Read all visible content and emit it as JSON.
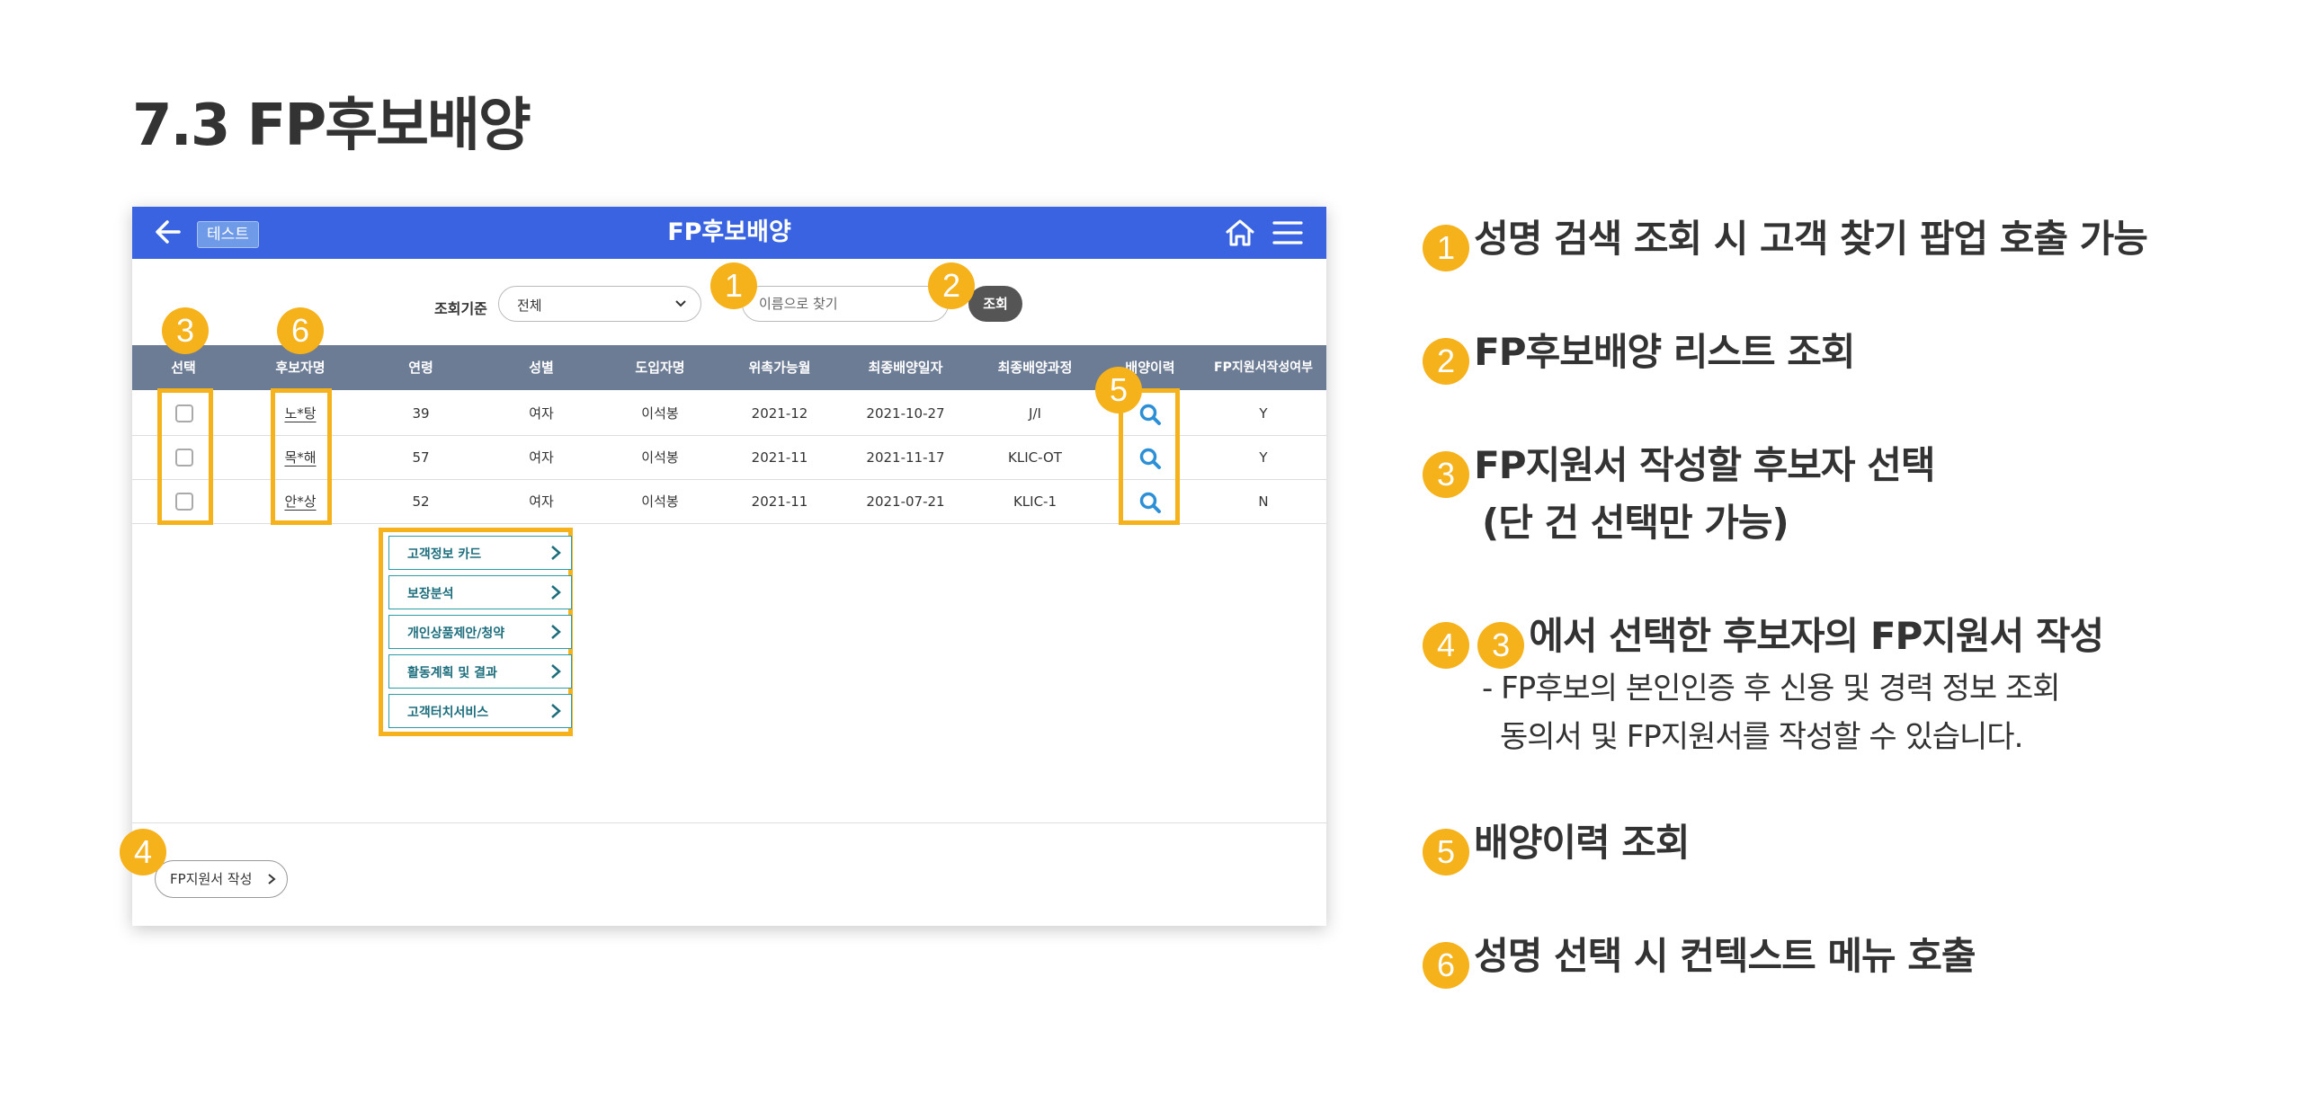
{
  "page_title": "7.3 FP후보배양",
  "app": {
    "badge": "테스트",
    "title": "FP후보배양",
    "filter_label": "조회기준",
    "filter_value": "전체",
    "search_placeholder": "이름으로 찾기",
    "search_button": "조회",
    "columns": [
      "선택",
      "후보자명",
      "연령",
      "성별",
      "도입자명",
      "위촉가능월",
      "최종배양일자",
      "최종배양과정",
      "배양이력",
      "FP지원서작성여부"
    ],
    "rows": [
      {
        "name": "노*탕",
        "age": "39",
        "gender": "여자",
        "recruiter": "이석봉",
        "month": "2021-12",
        "date": "2021-10-27",
        "course": "J/I",
        "written": "Y"
      },
      {
        "name": "목*해",
        "age": "57",
        "gender": "여자",
        "recruiter": "이석봉",
        "month": "2021-11",
        "date": "2021-11-17",
        "course": "KLIC-OT",
        "written": "Y"
      },
      {
        "name": "안*상",
        "age": "52",
        "gender": "여자",
        "recruiter": "이석봉",
        "month": "2021-11",
        "date": "2021-07-21",
        "course": "KLIC-1",
        "written": "N"
      }
    ],
    "context_menu": [
      "고객정보 카드",
      "보장분석",
      "개인상품제안/청약",
      "활동계획 및 결과",
      "고객터치서비스"
    ],
    "fp_button": "FP지원서 작성"
  },
  "markers": [
    "1",
    "2",
    "3",
    "4",
    "5",
    "6"
  ],
  "legend": [
    {
      "num": "1",
      "text": "성명 검색 조회 시 고객 찾기 팝업 호출 가능"
    },
    {
      "num": "2",
      "text": "FP후보배양 리스트 조회"
    },
    {
      "num": "3",
      "text": "FP지원서 작성할 후보자 선택",
      "text2": "(단 건 선택만 가능)"
    },
    {
      "num": "4",
      "ref": "3",
      "text": "에서 선택한 후보자의 FP지원서 작성",
      "sub1": "- FP후보의 본인인증 후 신용 및 경력 정보 조회",
      "sub2": "동의서 및 FP지원서를 작성할 수 있습니다."
    },
    {
      "num": "5",
      "text": "배양이력 조회"
    },
    {
      "num": "6",
      "text": "성명 선택 시 컨텍스트 메뉴 호출"
    }
  ],
  "colors": {
    "appbar": "#3963e0",
    "accent": "#f6b21b",
    "table_header": "#6d7c95",
    "menu_border": "#2e9ca8",
    "search_icon": "#2d8fd5"
  },
  "icons": [
    "back-arrow-icon",
    "home-icon",
    "menu-icon",
    "chevron-down-icon",
    "search-icon",
    "chevron-right-icon"
  ]
}
